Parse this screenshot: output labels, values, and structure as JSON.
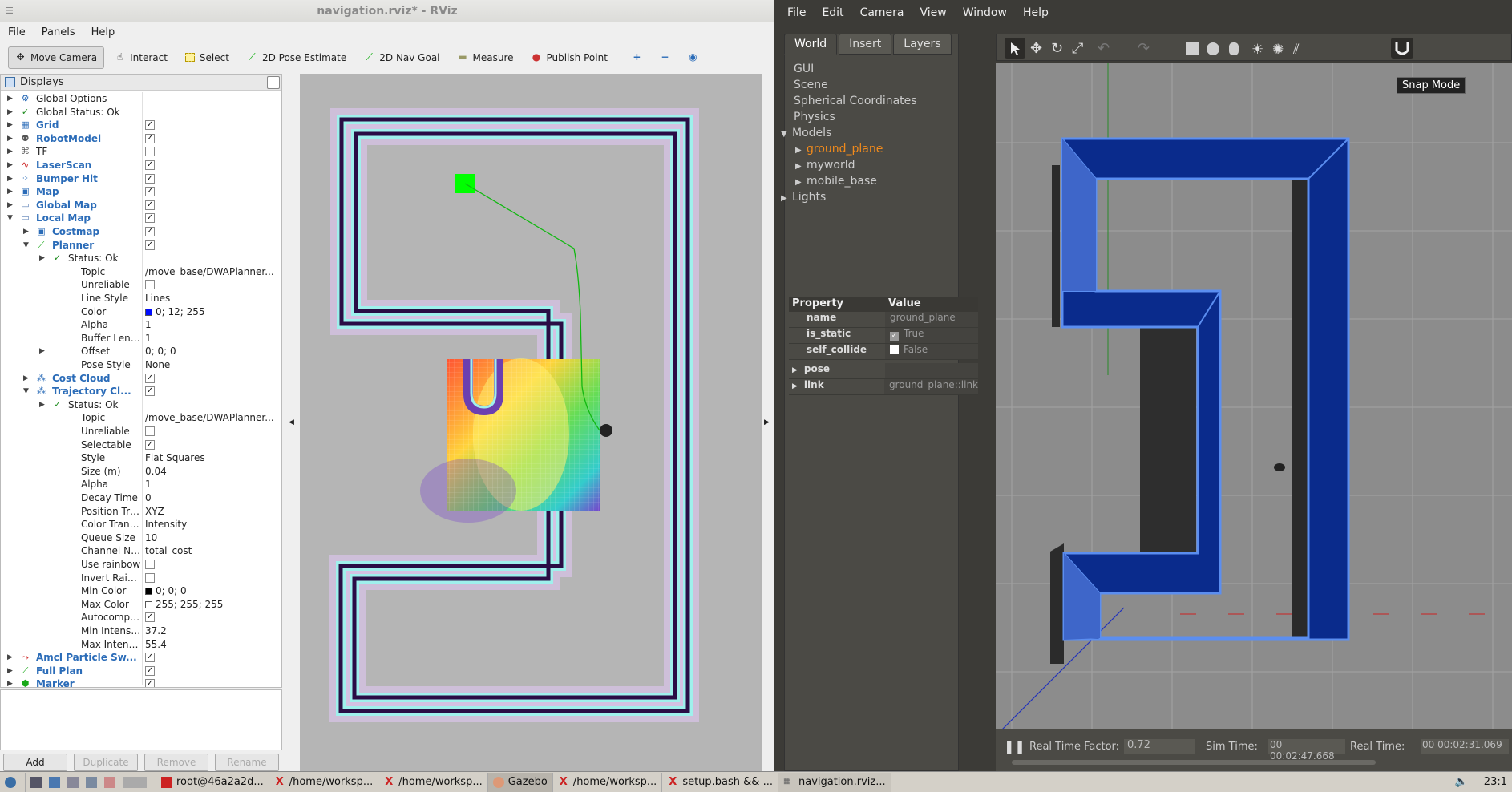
{
  "rviz": {
    "title": "navigation.rviz* - RViz",
    "menu": [
      "File",
      "Panels",
      "Help"
    ],
    "tools": [
      {
        "label": "Move Camera",
        "icon": "move-camera-icon",
        "active": true
      },
      {
        "label": "Interact",
        "icon": "interact-icon"
      },
      {
        "label": "Select",
        "icon": "select-icon"
      },
      {
        "label": "2D Pose Estimate",
        "icon": "pose-estimate-icon"
      },
      {
        "label": "2D Nav Goal",
        "icon": "nav-goal-icon"
      },
      {
        "label": "Measure",
        "icon": "measure-icon"
      },
      {
        "label": "Publish Point",
        "icon": "publish-point-icon"
      }
    ],
    "displays_title": "Displays",
    "rows": [
      {
        "level": 0,
        "arrow": "right",
        "icon": "gear-icon",
        "name": "Global Options",
        "bold": false
      },
      {
        "level": 0,
        "arrow": "right",
        "icon": "check-icon",
        "name": "Global Status: Ok",
        "bold": false
      },
      {
        "level": 0,
        "arrow": "right",
        "icon": "grid-icon",
        "name": "Grid",
        "bold": true,
        "checked": true
      },
      {
        "level": 0,
        "arrow": "right",
        "icon": "robot-icon",
        "name": "RobotModel",
        "bold": true,
        "checked": true
      },
      {
        "level": 0,
        "arrow": "right",
        "icon": "tf-icon",
        "name": "TF",
        "bold": false,
        "checked": false
      },
      {
        "level": 0,
        "arrow": "right",
        "icon": "laser-icon",
        "name": "LaserScan",
        "bold": true,
        "checked": true
      },
      {
        "level": 0,
        "arrow": "right",
        "icon": "bumper-icon",
        "name": "Bumper Hit",
        "bold": true,
        "checked": true
      },
      {
        "level": 0,
        "arrow": "right",
        "icon": "map-icon",
        "name": "Map",
        "bold": true,
        "checked": true
      },
      {
        "level": 0,
        "arrow": "right",
        "icon": "folder-icon",
        "name": "Global Map",
        "bold": true,
        "checked": true
      },
      {
        "level": 0,
        "arrow": "down",
        "icon": "folder-icon",
        "name": "Local Map",
        "bold": true,
        "checked": true
      },
      {
        "level": 1,
        "arrow": "right",
        "icon": "map-icon",
        "name": "Costmap",
        "bold": true,
        "checked": true
      },
      {
        "level": 1,
        "arrow": "down",
        "icon": "path-icon",
        "name": "Planner",
        "bold": true,
        "checked": true
      },
      {
        "level": 2,
        "arrow": "right",
        "icon": "check-icon",
        "name": "Status: Ok",
        "bold": false
      },
      {
        "level": 2,
        "name": "Topic",
        "value": "/move_base/DWAPlanner..."
      },
      {
        "level": 2,
        "name": "Unreliable",
        "checked": false
      },
      {
        "level": 2,
        "name": "Line Style",
        "value": "Lines"
      },
      {
        "level": 2,
        "name": "Color",
        "value": "0; 12; 255",
        "swatch": "#000cff"
      },
      {
        "level": 2,
        "name": "Alpha",
        "value": "1"
      },
      {
        "level": 2,
        "name": "Buffer Length",
        "value": "1"
      },
      {
        "level": 2,
        "arrow": "right",
        "name": "Offset",
        "value": "0; 0; 0"
      },
      {
        "level": 2,
        "name": "Pose Style",
        "value": "None"
      },
      {
        "level": 1,
        "arrow": "right",
        "icon": "cloud-icon",
        "name": "Cost Cloud",
        "bold": true,
        "checked": true
      },
      {
        "level": 1,
        "arrow": "down",
        "icon": "cloud-icon",
        "name": "Trajectory Cl...",
        "bold": true,
        "checked": true
      },
      {
        "level": 2,
        "arrow": "right",
        "icon": "check-icon",
        "name": "Status: Ok",
        "bold": false
      },
      {
        "level": 2,
        "name": "Topic",
        "value": "/move_base/DWAPlanner..."
      },
      {
        "level": 2,
        "name": "Unreliable",
        "checked": false
      },
      {
        "level": 2,
        "name": "Selectable",
        "checked": true
      },
      {
        "level": 2,
        "name": "Style",
        "value": "Flat Squares"
      },
      {
        "level": 2,
        "name": "Size (m)",
        "value": "0.04"
      },
      {
        "level": 2,
        "name": "Alpha",
        "value": "1"
      },
      {
        "level": 2,
        "name": "Decay Time",
        "value": "0"
      },
      {
        "level": 2,
        "name": "Position Transfo...",
        "value": "XYZ"
      },
      {
        "level": 2,
        "name": "Color Transfor...",
        "value": "Intensity"
      },
      {
        "level": 2,
        "name": "Queue Size",
        "value": "10"
      },
      {
        "level": 2,
        "name": "Channel Name",
        "value": "total_cost"
      },
      {
        "level": 2,
        "name": "Use rainbow",
        "checked": false
      },
      {
        "level": 2,
        "name": "Invert Rainbow",
        "checked": false
      },
      {
        "level": 2,
        "name": "Min Color",
        "value": "0; 0; 0",
        "swatch": "#000000"
      },
      {
        "level": 2,
        "name": "Max Color",
        "value": "255; 255; 255",
        "swatch": "#ffffff"
      },
      {
        "level": 2,
        "name": "Autocompute In...",
        "checked": true
      },
      {
        "level": 2,
        "name": "Min Intensity",
        "value": "37.2"
      },
      {
        "level": 2,
        "name": "Max Intensity",
        "value": "55.4"
      },
      {
        "level": 0,
        "arrow": "right",
        "icon": "particles-icon",
        "name": "Amcl Particle Sw...",
        "bold": true,
        "checked": true
      },
      {
        "level": 0,
        "arrow": "right",
        "icon": "path-icon",
        "name": "Full Plan",
        "bold": true,
        "checked": true
      },
      {
        "level": 0,
        "arrow": "right",
        "icon": "marker-icon",
        "name": "Marker",
        "bold": true,
        "checked": true
      }
    ],
    "buttons": {
      "add": "Add",
      "duplicate": "Duplicate",
      "remove": "Remove",
      "rename": "Rename"
    }
  },
  "gazebo": {
    "menu": [
      "File",
      "Edit",
      "Camera",
      "View",
      "Window",
      "Help"
    ],
    "tabs": [
      "World",
      "Insert",
      "Layers"
    ],
    "world_tree": [
      {
        "label": "GUI",
        "level": 0
      },
      {
        "label": "Scene",
        "level": 0
      },
      {
        "label": "Spherical Coordinates",
        "level": 0
      },
      {
        "label": "Physics",
        "level": 0
      },
      {
        "label": "Models",
        "level": 0,
        "arrow": "down"
      },
      {
        "label": "ground_plane",
        "level": 1,
        "arrow": "right",
        "selected": true
      },
      {
        "label": "myworld",
        "level": 1,
        "arrow": "right"
      },
      {
        "label": "mobile_base",
        "level": 1,
        "arrow": "right"
      },
      {
        "label": "Lights",
        "level": 0,
        "arrow": "right"
      }
    ],
    "prop_header": {
      "k": "Property",
      "v": "Value"
    },
    "props": [
      {
        "k": "name",
        "v": "ground_plane"
      },
      {
        "k": "is_static",
        "v": "True",
        "check": true
      },
      {
        "k": "self_collide",
        "v": "False",
        "check": false
      },
      {
        "k": "pose",
        "v": "",
        "arrow": true
      },
      {
        "k": "link",
        "v": "ground_plane::link",
        "arrow": true
      }
    ],
    "tooltip": "Snap Mode",
    "status": {
      "rtf_label": "Real Time Factor:",
      "rtf": "0.72",
      "sim_label": "Sim Time:",
      "sim": "00 00:02:47.668",
      "real_label": "Real Time:",
      "real": "00 00:02:31.069"
    }
  },
  "taskbar": {
    "items": [
      "root@46a2a2d...",
      "/home/worksp...",
      "/home/worksp...",
      "Gazebo",
      "/home/worksp...",
      "setup.bash && ...",
      "navigation.rviz..."
    ],
    "clock": "23:1"
  },
  "colors": {
    "accent": "#2b6cb8",
    "wall_blue": "#0a2b8c",
    "nav_goal": "#00ff00"
  }
}
